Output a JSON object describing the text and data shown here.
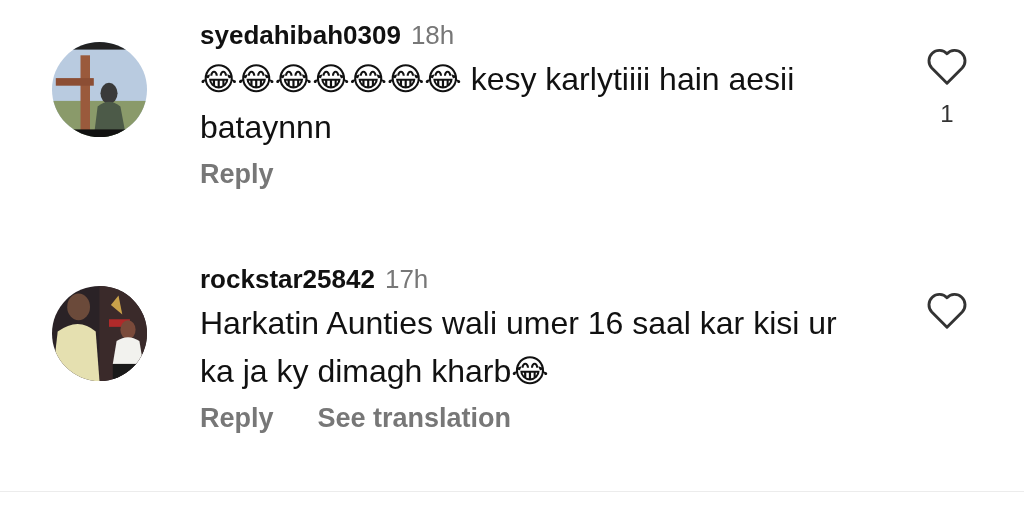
{
  "comments": [
    {
      "username": "syedahibah0309",
      "time": "18h",
      "text": "😂😂😂😂😂😂😂 kesy karlytiiii hain aesii bataynnn",
      "avatar": {
        "kind": "picture"
      },
      "actions": [
        "Reply"
      ],
      "like_count": "1"
    },
    {
      "username": "rockstar25842",
      "time": "17h",
      "text": "Harkatin Aunties wali umer 16 saal kar kisi ur ka ja ky dimagh kharb😂",
      "avatar": {
        "kind": "picture"
      },
      "actions": [
        "Reply",
        "See translation"
      ]
    }
  ]
}
